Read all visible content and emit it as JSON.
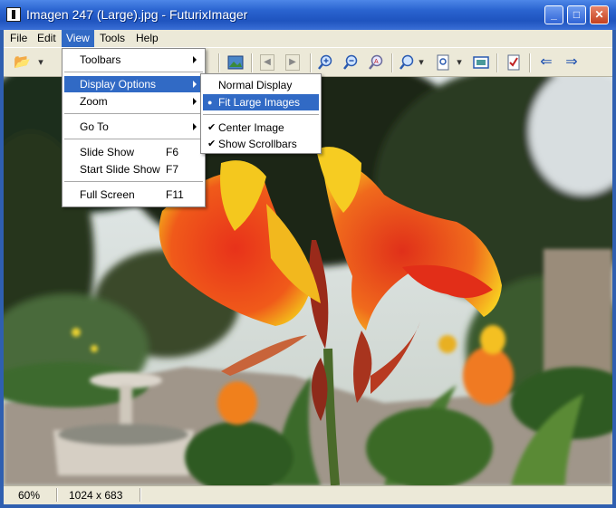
{
  "window": {
    "title": "Imagen 247 (Large).jpg - FuturixImager",
    "minimize_glyph": "_",
    "maximize_glyph": "□",
    "close_glyph": "✕"
  },
  "menubar": [
    "File",
    "Edit",
    "View",
    "Tools",
    "Help"
  ],
  "toolbar": {
    "icons": [
      "open-folder-icon",
      "dropdown-arrow-icon",
      "image-icon",
      "previous-icon",
      "next-icon",
      "zoom-in-icon",
      "zoom-out-icon",
      "zoom-actual-icon",
      "zoom-dropdown-icon",
      "fit-page-icon",
      "dropdown-arrow-icon",
      "fullscreen-icon",
      "properties-icon",
      "back-arrow-icon",
      "forward-arrow-icon"
    ],
    "glyphs": {
      "open": "📂",
      "arrow": "▾",
      "prev": "◀",
      "next": "▶",
      "zoom_in": "+",
      "zoom_out": "−",
      "back": "⇐",
      "forward": "⇒"
    }
  },
  "view_menu": {
    "items": [
      {
        "label": "Toolbars",
        "shortcut": "",
        "submenu": true
      },
      {
        "label": "Display Options",
        "shortcut": "",
        "submenu": true,
        "highlighted": true
      },
      {
        "label": "Zoom",
        "shortcut": "",
        "submenu": true
      },
      {
        "label": "Go To",
        "shortcut": "",
        "submenu": true
      },
      {
        "label": "Slide Show",
        "shortcut": "F6"
      },
      {
        "label": "Start Slide Show",
        "shortcut": "F7"
      },
      {
        "label": "Full Screen",
        "shortcut": "F11"
      }
    ]
  },
  "display_options_menu": {
    "items": [
      {
        "label": "Normal Display",
        "mark": ""
      },
      {
        "label": "Fit Large Images",
        "mark": "●",
        "highlighted": true
      },
      {
        "label": "Center Image",
        "mark": "✔"
      },
      {
        "label": "Show Scrollbars",
        "mark": "✔"
      }
    ]
  },
  "statusbar": {
    "zoom": "60%",
    "dimensions": "1024 x 683"
  },
  "colors": {
    "titlebar": "#2a63cf",
    "menu_highlight": "#316ac5",
    "chrome": "#ece9d8"
  }
}
